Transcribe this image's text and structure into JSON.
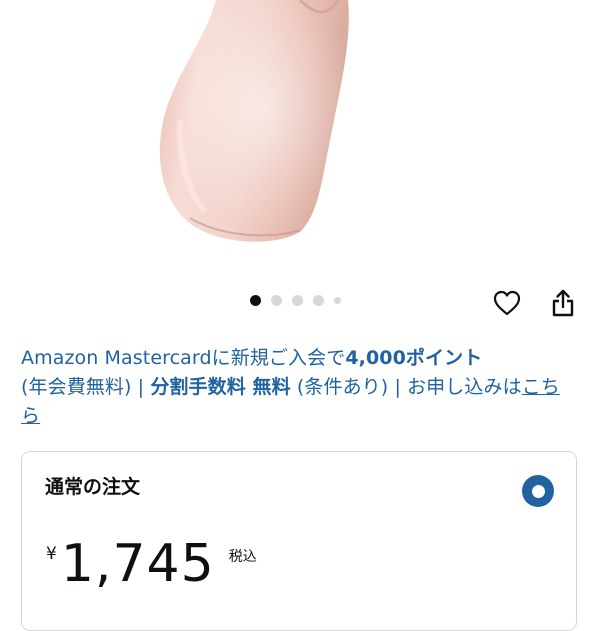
{
  "gallery": {
    "image_alt": "pink satin product",
    "dot_count": 5,
    "active_index": 0
  },
  "actions": {
    "favorite_icon": "heart-icon",
    "share_icon": "share-icon"
  },
  "promo": {
    "part1": "Amazon Mastercardに新規ご入会で",
    "points": "4,000ポイント",
    "part2": "(年会費無料) | ",
    "installment": "分割手数料 無料",
    "part3": " (条件あり) | お申し込みは",
    "link": "こちら"
  },
  "order": {
    "title": "通常の注文",
    "currency": "¥",
    "price": "1,745",
    "tax_label": "税込",
    "selected": true
  },
  "colors": {
    "link": "#2162a1",
    "text": "#0f1111",
    "product": "#f0cfc6",
    "border": "#d5d9d9"
  }
}
